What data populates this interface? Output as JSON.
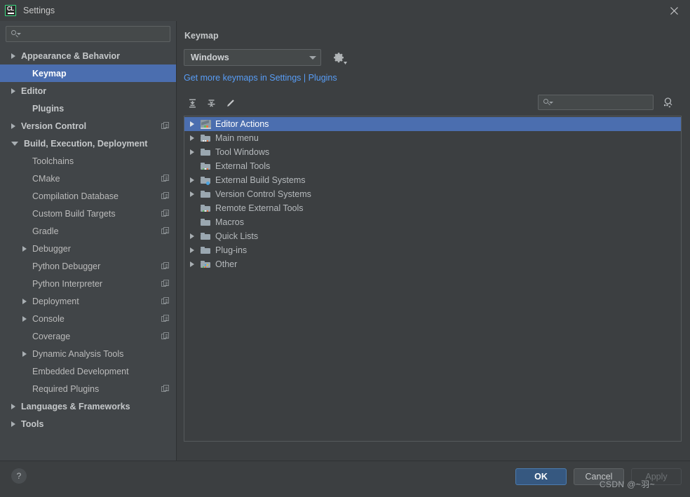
{
  "window": {
    "title": "Settings",
    "logo_text": "CL",
    "close_icon": "close-icon"
  },
  "sidebar": {
    "search_placeholder": "",
    "search_value": "",
    "items": [
      {
        "label": "Appearance & Behavior",
        "level": 0,
        "arrow": "right",
        "bold": true,
        "badge": false,
        "selected": false
      },
      {
        "label": "Keymap",
        "level": 1,
        "arrow": "none",
        "bold": true,
        "badge": false,
        "selected": true
      },
      {
        "label": "Editor",
        "level": 0,
        "arrow": "right",
        "bold": true,
        "badge": false,
        "selected": false
      },
      {
        "label": "Plugins",
        "level": 1,
        "arrow": "none",
        "bold": true,
        "badge": false,
        "selected": false
      },
      {
        "label": "Version Control",
        "level": 0,
        "arrow": "right",
        "bold": true,
        "badge": true,
        "selected": false
      },
      {
        "label": "Build, Execution, Deployment",
        "level": 0,
        "arrow": "down",
        "bold": true,
        "badge": false,
        "selected": false
      },
      {
        "label": "Toolchains",
        "level": 2,
        "arrow": "none",
        "bold": false,
        "badge": false,
        "selected": false
      },
      {
        "label": "CMake",
        "level": 2,
        "arrow": "none",
        "bold": false,
        "badge": true,
        "selected": false
      },
      {
        "label": "Compilation Database",
        "level": 2,
        "arrow": "none",
        "bold": false,
        "badge": true,
        "selected": false
      },
      {
        "label": "Custom Build Targets",
        "level": 2,
        "arrow": "none",
        "bold": false,
        "badge": true,
        "selected": false
      },
      {
        "label": "Gradle",
        "level": 2,
        "arrow": "none",
        "bold": false,
        "badge": true,
        "selected": false
      },
      {
        "label": "Debugger",
        "level": 1,
        "arrow": "right",
        "bold": false,
        "badge": false,
        "selected": false
      },
      {
        "label": "Python Debugger",
        "level": 2,
        "arrow": "none",
        "bold": false,
        "badge": true,
        "selected": false
      },
      {
        "label": "Python Interpreter",
        "level": 2,
        "arrow": "none",
        "bold": false,
        "badge": true,
        "selected": false
      },
      {
        "label": "Deployment",
        "level": 1,
        "arrow": "right",
        "bold": false,
        "badge": true,
        "selected": false
      },
      {
        "label": "Console",
        "level": 1,
        "arrow": "right",
        "bold": false,
        "badge": true,
        "selected": false
      },
      {
        "label": "Coverage",
        "level": 2,
        "arrow": "none",
        "bold": false,
        "badge": true,
        "selected": false
      },
      {
        "label": "Dynamic Analysis Tools",
        "level": 1,
        "arrow": "right",
        "bold": false,
        "badge": false,
        "selected": false
      },
      {
        "label": "Embedded Development",
        "level": 2,
        "arrow": "none",
        "bold": false,
        "badge": false,
        "selected": false
      },
      {
        "label": "Required Plugins",
        "level": 2,
        "arrow": "none",
        "bold": false,
        "badge": true,
        "selected": false
      },
      {
        "label": "Languages & Frameworks",
        "level": 0,
        "arrow": "right",
        "bold": true,
        "badge": false,
        "selected": false
      },
      {
        "label": "Tools",
        "level": 0,
        "arrow": "right",
        "bold": true,
        "badge": false,
        "selected": false
      }
    ]
  },
  "main": {
    "panel_title": "Keymap",
    "keymap_selected": "Windows",
    "gear_icon": "gear-icon",
    "plugins_link": "Get more keymaps in Settings | Plugins",
    "toolbar": {
      "expand_all_icon": "expand-all-icon",
      "collapse_all_icon": "collapse-all-icon",
      "edit_icon": "edit-pencil-icon",
      "search_value": "",
      "search_placeholder": "",
      "find_shortcut_icon": "find-by-shortcut-icon"
    },
    "tree": [
      {
        "label": "Editor Actions",
        "arrow": "right",
        "icon": "editor",
        "selected": true
      },
      {
        "label": "Main menu",
        "arrow": "right",
        "icon": "menu",
        "selected": false
      },
      {
        "label": "Tool Windows",
        "arrow": "right",
        "icon": "plain",
        "selected": false
      },
      {
        "label": "External Tools",
        "arrow": "none",
        "icon": "ext",
        "selected": false
      },
      {
        "label": "External Build Systems",
        "arrow": "right",
        "icon": "build",
        "selected": false
      },
      {
        "label": "Version Control Systems",
        "arrow": "right",
        "icon": "plain",
        "selected": false
      },
      {
        "label": "Remote External Tools",
        "arrow": "none",
        "icon": "ext",
        "selected": false
      },
      {
        "label": "Macros",
        "arrow": "none",
        "icon": "plain",
        "selected": false
      },
      {
        "label": "Quick Lists",
        "arrow": "right",
        "icon": "plain",
        "selected": false
      },
      {
        "label": "Plug-ins",
        "arrow": "right",
        "icon": "plain",
        "selected": false
      },
      {
        "label": "Other",
        "arrow": "right",
        "icon": "other",
        "selected": false
      }
    ]
  },
  "footer": {
    "help_label": "?",
    "ok_label": "OK",
    "cancel_label": "Cancel",
    "apply_label": "Apply",
    "watermark": "CSDN @~羽~"
  },
  "colors": {
    "selection_blue": "#4b6eaf",
    "primary_button": "#365880",
    "link_blue": "#589df6",
    "panel_bg": "#3c3f41",
    "sidebar_bg": "#414548"
  }
}
